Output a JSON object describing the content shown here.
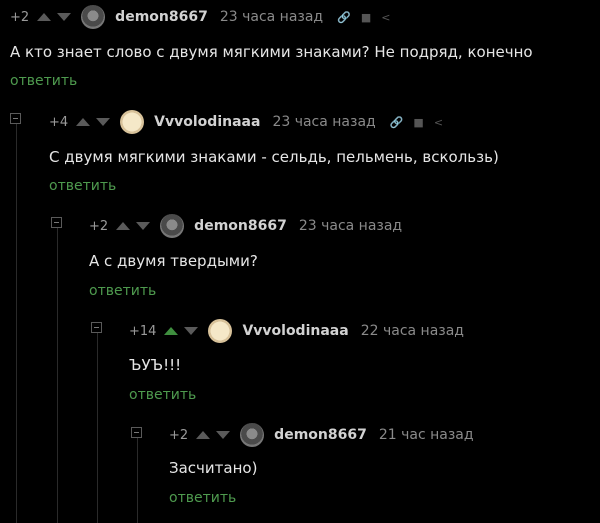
{
  "comments": [
    {
      "rating": "+2",
      "author": "demon8667",
      "time": "23 часа назад",
      "text": "А кто знает слово с двумя мягкими знаками? Не подряд, конечно",
      "reply_label": "ответить",
      "avatar": "cat-avatar",
      "upvote_active": false
    },
    {
      "rating": "+4",
      "author": "Vvvolodinaaa",
      "time": "23 часа назад",
      "text": "С двумя мягкими знаками - сельдь, пельмень, вскользь)",
      "reply_label": "ответить",
      "avatar": "face-avatar",
      "upvote_active": false
    },
    {
      "rating": "+2",
      "author": "demon8667",
      "time": "23 часа назад",
      "text": "А с двумя твердыми?",
      "reply_label": "ответить",
      "avatar": "cat-avatar",
      "upvote_active": false
    },
    {
      "rating": "+14",
      "author": "Vvvolodinaaa",
      "time": "22 часа назад",
      "text": "ЪУЪ!!!",
      "reply_label": "ответить",
      "avatar": "face-avatar",
      "upvote_active": true
    },
    {
      "rating": "+2",
      "author": "demon8667",
      "time": "21 час назад",
      "text": "Засчитано)",
      "reply_label": "ответить",
      "avatar": "cat-avatar",
      "upvote_active": false
    }
  ],
  "colors": {
    "background": "#000000",
    "reply_link": "#4e9a4e",
    "upvote_active": "#3f8f3f",
    "text": "#e6e6e6"
  },
  "icons": [
    "link-icon",
    "save-icon",
    "share-icon",
    "collapse-icon",
    "upvote-icon",
    "downvote-icon"
  ]
}
